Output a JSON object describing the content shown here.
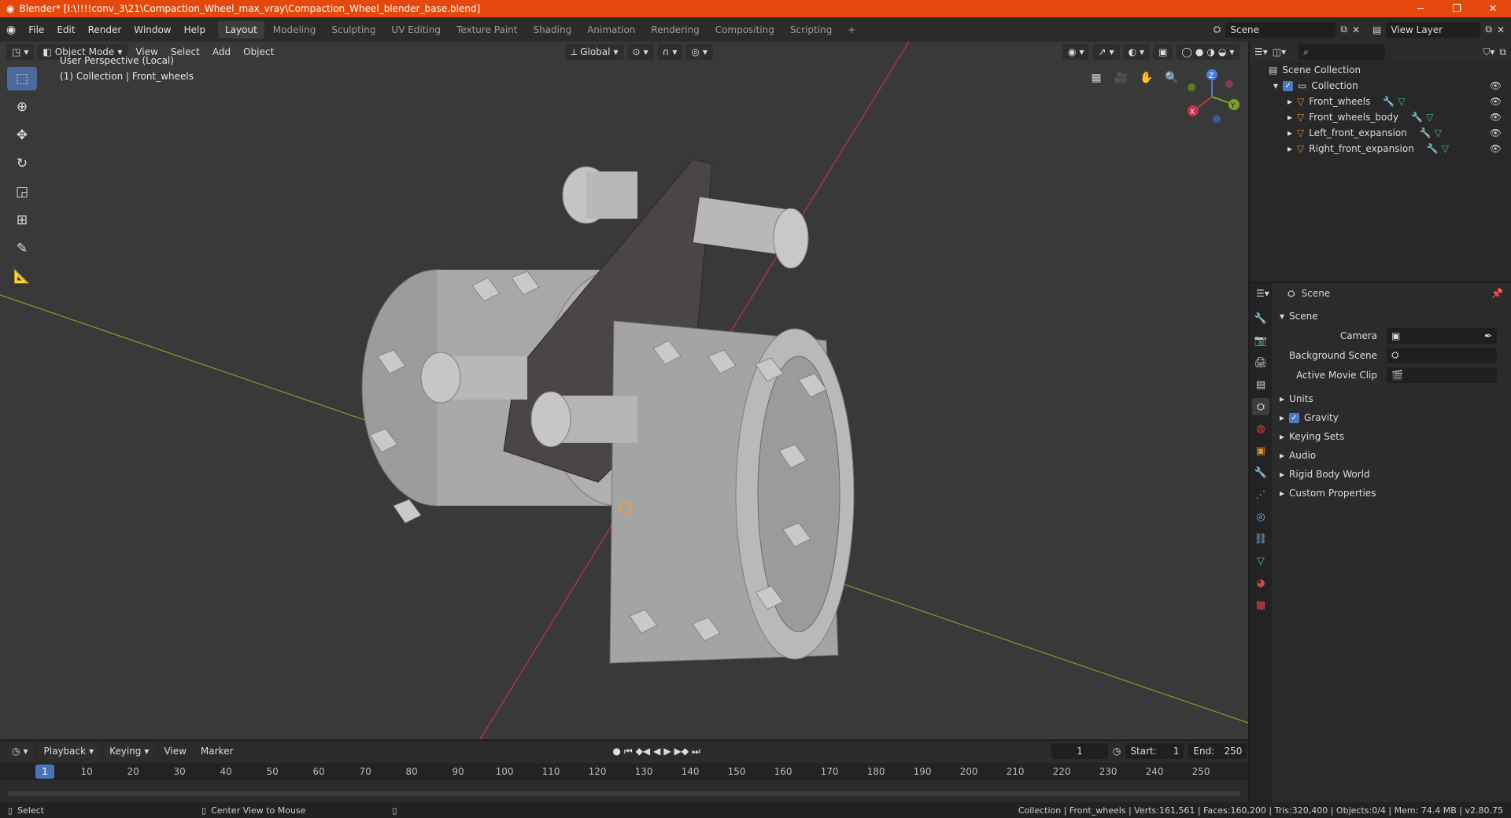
{
  "titlebar": {
    "title": "Blender* [I:\\!!!!conv_3\\21\\Compaction_Wheel_max_vray\\Compaction_Wheel_blender_base.blend]",
    "min": "─",
    "max": "❐",
    "close": "✕"
  },
  "menu": {
    "file": "File",
    "edit": "Edit",
    "render": "Render",
    "window": "Window",
    "help": "Help"
  },
  "workspaces": [
    "Layout",
    "Modeling",
    "Sculpting",
    "UV Editing",
    "Texture Paint",
    "Shading",
    "Animation",
    "Rendering",
    "Compositing",
    "Scripting"
  ],
  "add_ws": "+",
  "scene_field": "Scene",
  "viewlayer_field": "View Layer",
  "viewport": {
    "mode": "Object Mode",
    "menus": {
      "view": "View",
      "select": "Select",
      "add": "Add",
      "object": "Object"
    },
    "orientation": "Global",
    "perspective": "User Perspective (Local)",
    "collection_info": "(1) Collection | Front_wheels",
    "gizmo": {
      "x": "X",
      "y": "Y",
      "z": "Z"
    }
  },
  "outliner": {
    "root": "Scene Collection",
    "collection": "Collection",
    "objects": [
      "Front_wheels",
      "Front_wheels_body",
      "Left_front_expansion",
      "Right_front_expansion"
    ]
  },
  "properties": {
    "context": "Scene",
    "panel": "Scene",
    "camera_label": "Camera",
    "bg_scene_label": "Background Scene",
    "movie_clip_label": "Active Movie Clip",
    "sections": [
      "Units",
      "Gravity",
      "Keying Sets",
      "Audio",
      "Rigid Body World",
      "Custom Properties"
    ]
  },
  "timeline": {
    "playback": "Playback",
    "keying": "Keying",
    "view": "View",
    "marker": "Marker",
    "current_frame": "1",
    "start_label": "Start:",
    "start": "1",
    "end_label": "End:",
    "end": "250",
    "ticks": [
      "10",
      "20",
      "30",
      "40",
      "50",
      "60",
      "70",
      "80",
      "90",
      "100",
      "110",
      "120",
      "130",
      "140",
      "150",
      "160",
      "170",
      "180",
      "190",
      "200",
      "210",
      "220",
      "230",
      "240",
      "250"
    ],
    "cursor": "1"
  },
  "statusbar": {
    "select": "Select",
    "center_view": "Center View to Mouse",
    "stats": "Collection | Front_wheels | Verts:161,561 | Faces:160,200 | Tris:320,400 | Objects:0/4 | Mem: 74.4 MB | v2.80.75"
  },
  "colors": {
    "accent": "#4a72b8",
    "titlebar": "#e4480c",
    "x_axis": "#c8324a",
    "y_axis": "#7ca12a"
  }
}
